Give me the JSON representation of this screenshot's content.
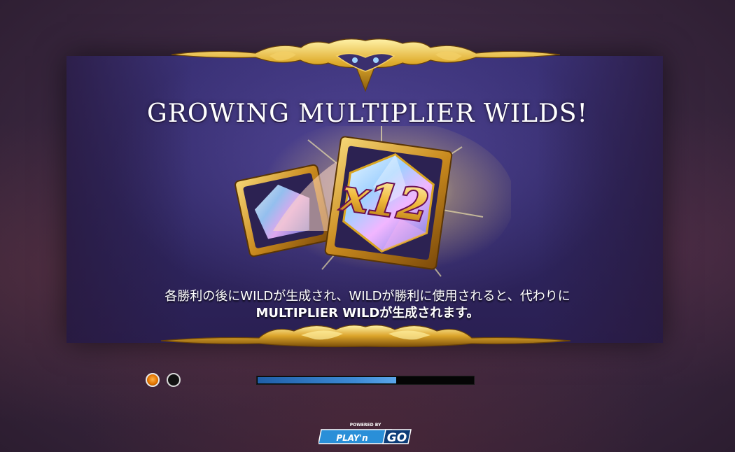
{
  "screen": {
    "title": "GROWING MULTIPLIER WILDS!",
    "multiplier_label": "x12",
    "description_lines": [
      "各勝利の後にWILDが生成され、WILDが勝利に使用されると、代わりに",
      "MULTIPLIER WILDが生成されます。"
    ]
  },
  "pagination": {
    "total_pages": 2,
    "current_page": 1
  },
  "loading": {
    "progress_fraction": 0.645
  },
  "brand": {
    "powered_by": "POWERED BY",
    "logo_text_play": "PLAY'n",
    "logo_text_go": "GO"
  },
  "colors": {
    "accent_gold": "#d9a521",
    "progress_blue": "#3d8ad4",
    "dot_active": "#e27400"
  }
}
